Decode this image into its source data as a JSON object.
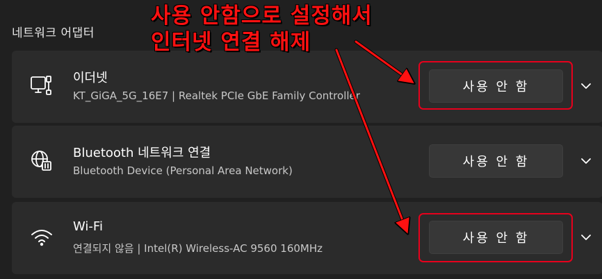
{
  "section_title": "네트워크 어댑터",
  "annotation": {
    "line1": "사용 안함으로 설정해서",
    "line2": "인터넷 연결 해제",
    "color": "#ff1111"
  },
  "adapters": [
    {
      "name": "이더넷",
      "description": "KT_GiGA_5G_16E7 | Realtek PCIe GbE Family Controller",
      "button_label": "사용 안 함",
      "icon": "ethernet-icon"
    },
    {
      "name": "Bluetooth 네트워크 연결",
      "description": "Bluetooth Device (Personal Area Network)",
      "button_label": "사용 안 함",
      "icon": "bluetooth-network-icon"
    },
    {
      "name": "Wi-Fi",
      "description": "연결되지 않음 | Intel(R) Wireless-AC 9560 160MHz",
      "button_label": "사용 안 함",
      "icon": "wifi-icon"
    }
  ],
  "colors": {
    "background": "#202020",
    "card": "#2b2b2b",
    "button": "#373737",
    "highlight": "#e8001c"
  }
}
